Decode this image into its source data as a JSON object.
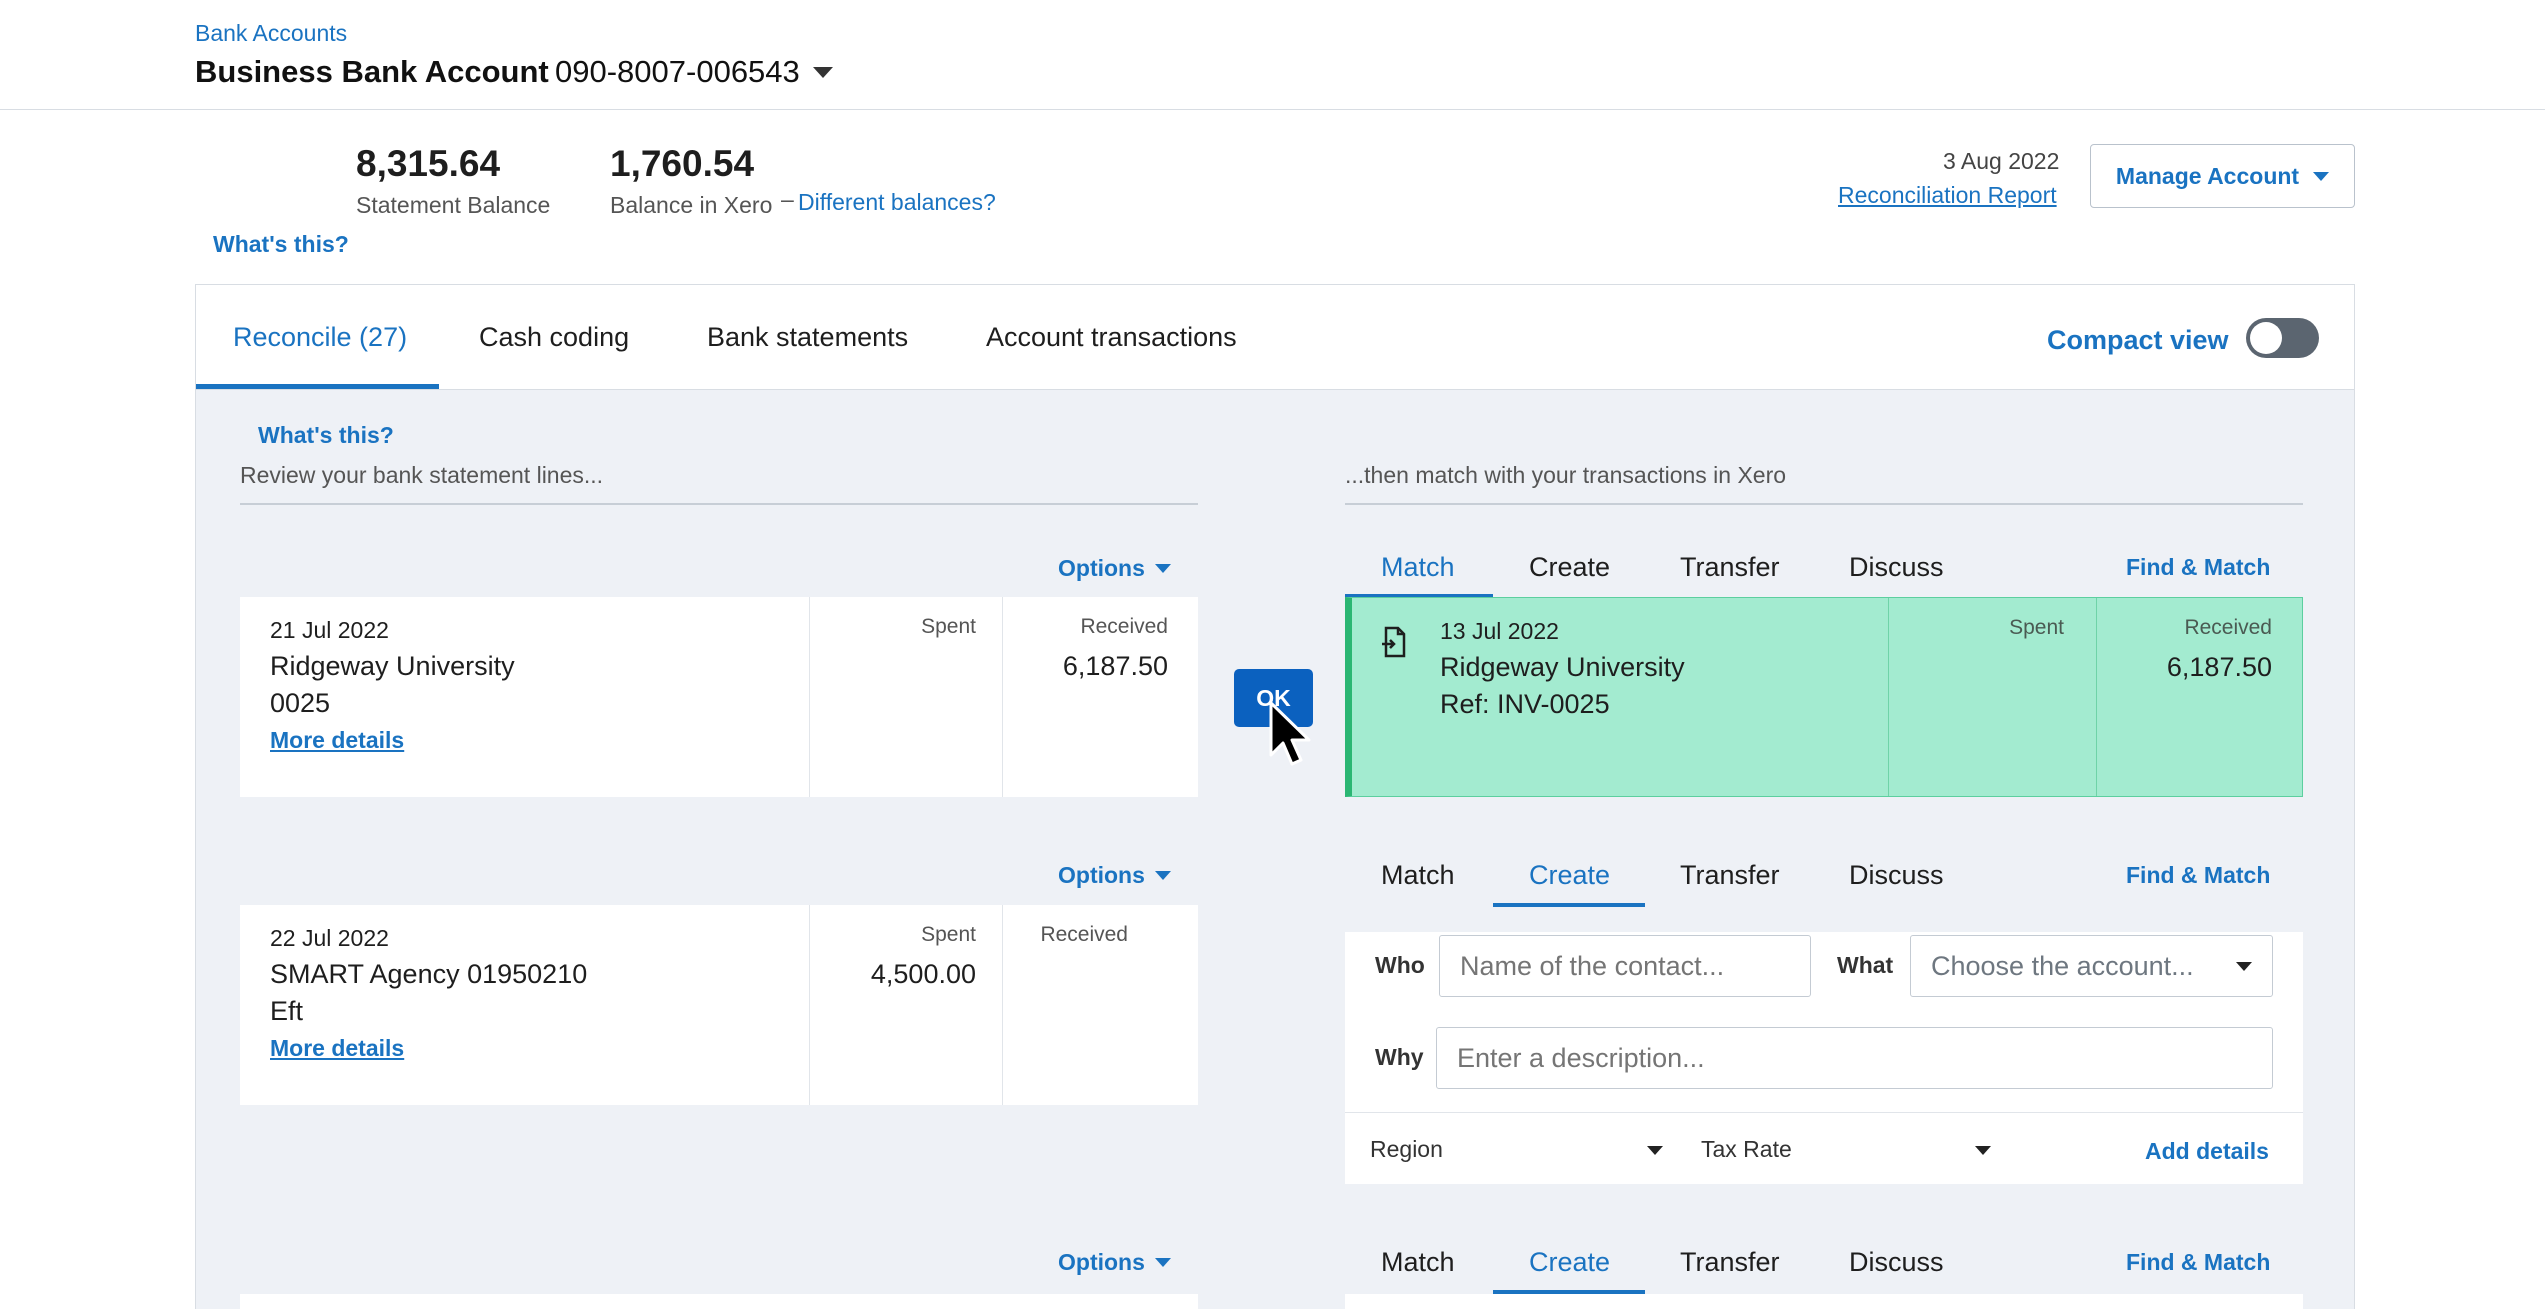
{
  "header": {
    "breadcrumb": "Bank Accounts",
    "account_name": "Business Bank Account",
    "account_number": "090-8007-006543"
  },
  "balances": {
    "statement_value": "8,315.64",
    "statement_label": "Statement Balance",
    "xero_value": "1,760.54",
    "xero_label": "Balance in Xero",
    "xero_dash": "–",
    "different_link": "Different balances?",
    "whats_this": "What's this?"
  },
  "reconciliation": {
    "date": "3 Aug 2022",
    "report_link": "Reconciliation Report",
    "manage_button": "Manage Account"
  },
  "tabs": [
    {
      "label": "Reconcile (27)",
      "active": true
    },
    {
      "label": "Cash coding"
    },
    {
      "label": "Bank statements"
    },
    {
      "label": "Account transactions"
    }
  ],
  "compact_view": {
    "label": "Compact view",
    "on": false
  },
  "intro": {
    "whats_this": "What's this?",
    "left_text": "Review your bank statement lines...",
    "right_text": "...then match with your transactions in Xero"
  },
  "options_label": "Options",
  "ok_label": "OK",
  "right_tab_labels": {
    "match": "Match",
    "create": "Create",
    "transfer": "Transfer",
    "discuss": "Discuss",
    "find_match": "Find & Match"
  },
  "lines": [
    {
      "date": "21 Jul 2022",
      "payee": "Ridgeway University",
      "reference": "0025",
      "more": "More details",
      "spent_label": "Spent",
      "spent": "",
      "received_label": "Received",
      "received": "6,187.50",
      "active_right_tab": "match"
    },
    {
      "date": "22 Jul 2022",
      "payee": "SMART Agency 01950210",
      "reference": "Eft",
      "more": "More details",
      "spent_label": "Spent",
      "spent": "4,500.00",
      "received_label": "Received",
      "received": "",
      "active_right_tab": "create"
    },
    {
      "active_right_tab": "create"
    }
  ],
  "match_suggestion": {
    "date": "13 Jul 2022",
    "payee": "Ridgeway University",
    "reference": "Ref: INV-0025",
    "spent_label": "Spent",
    "received_label": "Received",
    "received": "6,187.50"
  },
  "create_form": {
    "who_label": "Who",
    "who_placeholder": "Name of the contact...",
    "what_label": "What",
    "what_placeholder": "Choose the account...",
    "why_label": "Why",
    "why_placeholder": "Enter a description...",
    "region_label": "Region",
    "tax_rate_label": "Tax Rate",
    "add_details": "Add details"
  },
  "colors": {
    "accent": "#1a73c1",
    "ok_button": "#0b61bf",
    "match_green": "#a3ebd0",
    "match_border": "#2bb673",
    "panel_bg": "#eef1f6"
  }
}
